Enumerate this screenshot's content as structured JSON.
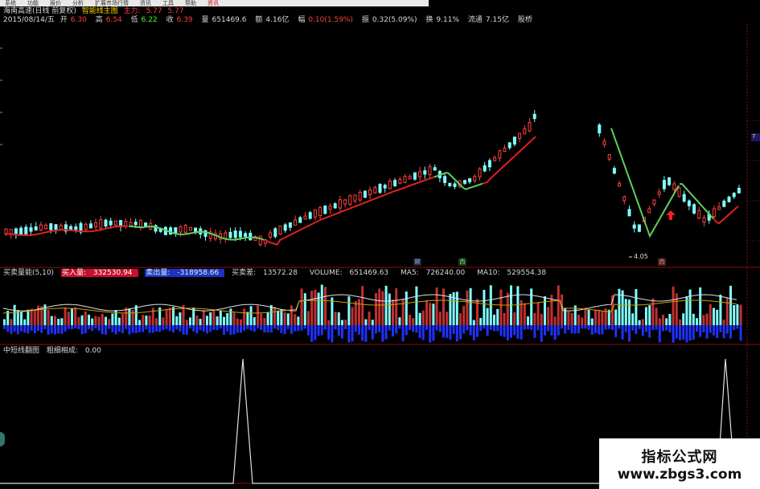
{
  "menu": {
    "items": [
      {
        "label": "系统",
        "active": false
      },
      {
        "label": "功能",
        "active": false
      },
      {
        "label": "报价",
        "active": false
      },
      {
        "label": "分析",
        "active": false
      },
      {
        "label": "扩展市场行情",
        "active": false
      },
      {
        "label": "资讯",
        "active": false
      },
      {
        "label": "工具",
        "active": false
      },
      {
        "label": "帮助",
        "active": false
      },
      {
        "label": "资讯",
        "active": true
      }
    ]
  },
  "stock": {
    "title": "海南高速(日线 前复权)",
    "indicator": "智能线主图",
    "main_force_label": "主力:",
    "main_force_value1": "5.77",
    "main_force_value2": "5.77"
  },
  "ohlc": {
    "date": "2015/08/14/五",
    "open_label": "开",
    "open": "6.30",
    "high_label": "高",
    "high": "6.54",
    "low_label": "低",
    "low": "6.22",
    "close_label": "收",
    "close": "6.39",
    "volume_label": "量",
    "volume": "651469.6",
    "amount_label": "额",
    "amount": "4.16亿",
    "change_label": "幅",
    "change": "0.10(1.59%)",
    "amplitude_label": "振",
    "amplitude": "0.32(5.09%)",
    "turnover_label": "换",
    "turnover": "9.11%",
    "float_label": "流通",
    "float": "7.15亿",
    "extra": "股桥"
  },
  "price_axis_tag": "7",
  "low_label": "4.05",
  "markers": [
    "财",
    "西",
    "西"
  ],
  "volume_panel": {
    "title": "买卖量能(5,10)",
    "buy_label": "买入量:",
    "buy_value": "332530.94",
    "sell_label": "卖出量:",
    "sell_value": "-318958.66",
    "diff_label": "买卖差:",
    "diff_value": "13572.28",
    "volume_label": "VOLUME:",
    "volume_value": "651469.63",
    "ma5_label": "MA5:",
    "ma5_value": "726240.00",
    "ma10_label": "MA10:",
    "ma10_value": "529554.38"
  },
  "signal_panel": {
    "title": "中短线翻图",
    "label": "粗细相成:",
    "value": "0.00"
  },
  "watermark": {
    "title": "指标公式网",
    "url": "www.zbgs3.com"
  },
  "colors": {
    "up": "#ff4040",
    "down": "#7fffff",
    "ma_red": "#e02020",
    "ma_green": "#5ed05e",
    "buy_bar": "#c03030",
    "sell_bar": "#2030ff"
  }
}
